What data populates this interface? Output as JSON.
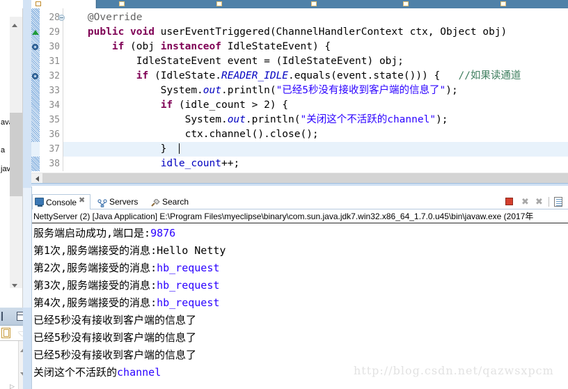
{
  "window": {
    "top_tabs": [
      {
        "label": "",
        "state": "inactive"
      },
      {
        "label": "",
        "state": "active"
      },
      {
        "label": "",
        "state": "inactive"
      },
      {
        "label": "",
        "state": "inactive"
      }
    ]
  },
  "left_strip": {
    "collapsed_labels": [
      "ava",
      "a",
      "jav"
    ]
  },
  "editor": {
    "first_line_number": 28,
    "highlighted_line": 37,
    "lines": [
      {
        "number": 28,
        "marker": "fold-collapse-icon",
        "tokens": [
          {
            "text": "    ",
            "type": "plain"
          },
          {
            "text": "@Override",
            "type": "annotation"
          }
        ]
      },
      {
        "number": 29,
        "marker": "green-triangle-marker",
        "tokens": [
          {
            "text": "    ",
            "type": "plain"
          },
          {
            "text": "public void",
            "type": "keyword"
          },
          {
            "text": " userEventTriggered(ChannelHandlerContext ctx, Object obj)",
            "type": "plain"
          }
        ]
      },
      {
        "number": 30,
        "marker": "breakpoint-dot-marker",
        "tokens": [
          {
            "text": "        ",
            "type": "plain"
          },
          {
            "text": "if",
            "type": "keyword"
          },
          {
            "text": " (obj ",
            "type": "plain"
          },
          {
            "text": "instanceof",
            "type": "keyword"
          },
          {
            "text": " IdleStateEvent) {",
            "type": "plain"
          }
        ]
      },
      {
        "number": 31,
        "marker": "",
        "tokens": [
          {
            "text": "            IdleStateEvent event = (IdleStateEvent) obj;",
            "type": "plain"
          }
        ]
      },
      {
        "number": 32,
        "marker": "breakpoint-dot-marker",
        "tokens": [
          {
            "text": "            ",
            "type": "plain"
          },
          {
            "text": "if",
            "type": "keyword"
          },
          {
            "text": " (IdleState.",
            "type": "plain"
          },
          {
            "text": "READER_IDLE",
            "type": "field"
          },
          {
            "text": ".equals(event.state())) {",
            "type": "plain"
          },
          {
            "text": "   //如果读通道",
            "type": "comment"
          }
        ]
      },
      {
        "number": 33,
        "marker": "",
        "tokens": [
          {
            "text": "                System.",
            "type": "plain"
          },
          {
            "text": "out",
            "type": "field"
          },
          {
            "text": ".println(",
            "type": "plain"
          },
          {
            "text": "\"已经5秒没有接收到客户端的信息了\"",
            "type": "string"
          },
          {
            "text": ");",
            "type": "plain"
          }
        ]
      },
      {
        "number": 34,
        "marker": "",
        "tokens": [
          {
            "text": "                ",
            "type": "plain"
          },
          {
            "text": "if",
            "type": "keyword"
          },
          {
            "text": " (idle_count > 2) {",
            "type": "plain"
          }
        ]
      },
      {
        "number": 35,
        "marker": "",
        "tokens": [
          {
            "text": "                    System.",
            "type": "plain"
          },
          {
            "text": "out",
            "type": "field"
          },
          {
            "text": ".println(",
            "type": "plain"
          },
          {
            "text": "\"关闭这个不活跃的channel\"",
            "type": "string"
          },
          {
            "text": ");",
            "type": "plain"
          }
        ]
      },
      {
        "number": 36,
        "marker": "",
        "tokens": [
          {
            "text": "                    ctx.channel().close();",
            "type": "plain"
          }
        ]
      },
      {
        "number": 37,
        "marker": "",
        "tokens": [
          {
            "text": "                }  ",
            "type": "plain"
          }
        ]
      },
      {
        "number": 38,
        "marker": "",
        "tokens": [
          {
            "text": "                ",
            "type": "plain"
          },
          {
            "text": "idle_count",
            "type": "blue"
          },
          {
            "text": "++;",
            "type": "plain"
          }
        ]
      }
    ]
  },
  "console": {
    "tabs": [
      {
        "label": "Console",
        "icon": "console-icon",
        "active": true,
        "closable": true
      },
      {
        "label": "Servers",
        "icon": "servers-icon",
        "active": false,
        "closable": false
      },
      {
        "label": "Search",
        "icon": "search-icon",
        "active": false,
        "closable": false
      }
    ],
    "toolbar": [
      {
        "name": "terminate-button",
        "icon": "stop-square-icon",
        "enabled": true
      },
      {
        "name": "remove-launch-button",
        "icon": "x-icon",
        "enabled": false
      },
      {
        "name": "remove-all-terminated-button",
        "icon": "x-multi-icon",
        "enabled": false
      },
      {
        "name": "display-selected-console-button",
        "icon": "document-icon",
        "enabled": true
      }
    ],
    "process_header": "NettyServer (2) [Java Application] E:\\Program Files\\myeclipse\\binary\\com.sun.java.jdk7.win32.x86_64_1.7.0.u45\\bin\\javaw.exe (2017年",
    "output_lines": [
      {
        "segments": [
          {
            "text": "服务端启动成功,端口是:",
            "type": "plain"
          },
          {
            "text": "9876",
            "type": "number"
          }
        ]
      },
      {
        "segments": [
          {
            "text": "第1次,服务端接受的消息:",
            "type": "plain"
          },
          {
            "text": "Hello Netty",
            "type": "plain"
          }
        ]
      },
      {
        "segments": [
          {
            "text": "第2次,服务端接受的消息:",
            "type": "plain"
          },
          {
            "text": "hb_request",
            "type": "number"
          }
        ]
      },
      {
        "segments": [
          {
            "text": "第3次,服务端接受的消息:",
            "type": "plain"
          },
          {
            "text": "hb_request",
            "type": "number"
          }
        ]
      },
      {
        "segments": [
          {
            "text": "第4次,服务端接受的消息:",
            "type": "plain"
          },
          {
            "text": "hb_request",
            "type": "number"
          }
        ]
      },
      {
        "segments": [
          {
            "text": "已经5秒没有接收到客户端的信息了",
            "type": "plain"
          }
        ]
      },
      {
        "segments": [
          {
            "text": "已经5秒没有接收到客户端的信息了",
            "type": "plain"
          }
        ]
      },
      {
        "segments": [
          {
            "text": "已经5秒没有接收到客户端的信息了",
            "type": "plain"
          }
        ]
      },
      {
        "segments": [
          {
            "text": "关闭这个不活跃的",
            "type": "plain"
          },
          {
            "text": "channel",
            "type": "number"
          }
        ]
      }
    ]
  },
  "watermark": {
    "text": "http://blog.csdn.net/qazwsxpcm"
  },
  "colors": {
    "keyword": "#7f0055",
    "string": "#2a00ff",
    "comment": "#3f7f5f",
    "field": "#0000c0",
    "line_number": "#8a8a8a",
    "highlight_row": "#e8f2fb",
    "tab_active": "#4f81a8",
    "stop_button": "#d43f2e"
  }
}
